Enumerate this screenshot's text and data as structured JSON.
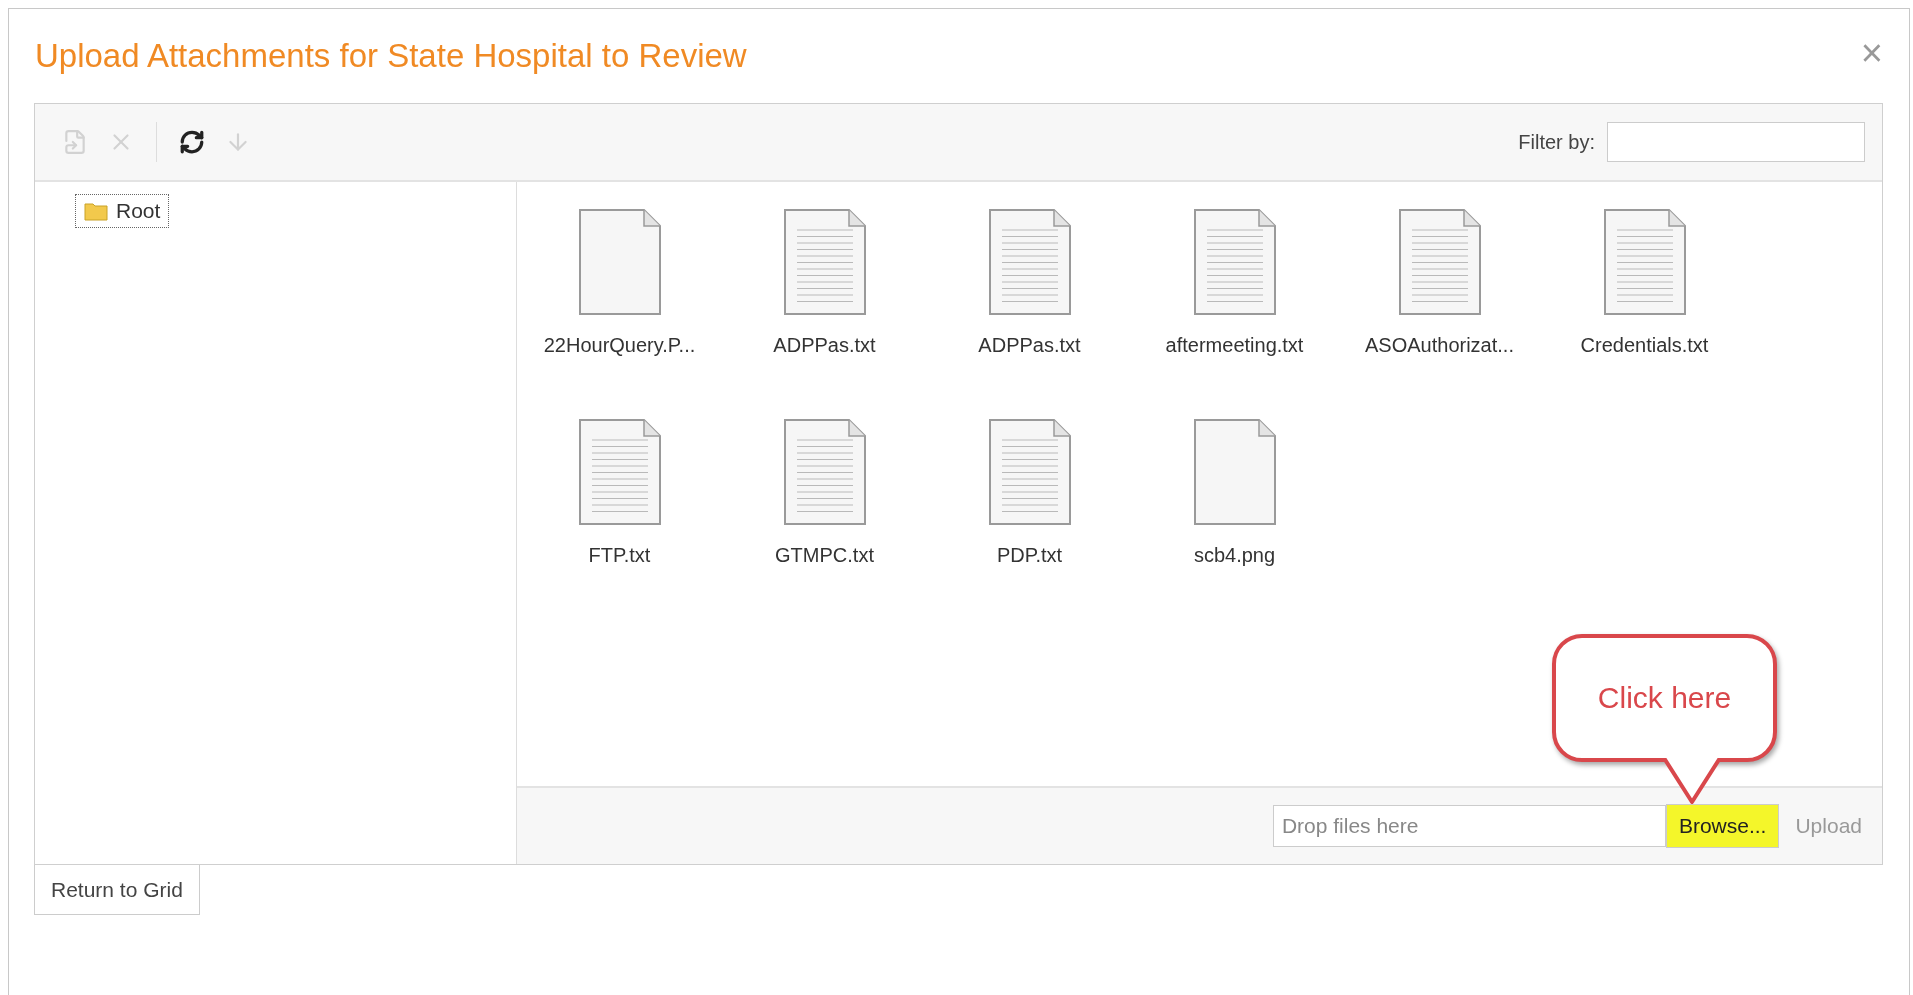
{
  "dialog": {
    "title": "Upload Attachments for State Hospital to Review",
    "close": "×"
  },
  "toolbar": {
    "tools": [
      {
        "kind": "new",
        "disabled": true
      },
      {
        "kind": "delete",
        "disabled": true
      },
      {
        "kind": "refresh",
        "disabled": false
      },
      {
        "kind": "download",
        "disabled": true
      }
    ],
    "filter_label": "Filter by:"
  },
  "tree": [
    {
      "label": "Root",
      "selected": true
    }
  ],
  "files": [
    {
      "name": "22HourQuery.P...",
      "kind": "blank"
    },
    {
      "name": "ADPPas.txt",
      "kind": "text"
    },
    {
      "name": "ADPPas.txt",
      "kind": "text"
    },
    {
      "name": "aftermeeting.txt",
      "kind": "text"
    },
    {
      "name": "ASOAuthorizat...",
      "kind": "text"
    },
    {
      "name": "Credentials.txt",
      "kind": "text"
    },
    {
      "name": "FTP.txt",
      "kind": "text"
    },
    {
      "name": "GTMPC.txt",
      "kind": "text"
    },
    {
      "name": "PDP.txt",
      "kind": "text"
    },
    {
      "name": "scb4.png",
      "kind": "blank"
    }
  ],
  "upload": {
    "placeholder": "Drop files here",
    "browse": {
      "label": "Browse...",
      "highlighted": true
    },
    "upload": {
      "label": "Upload",
      "disabled": true
    }
  },
  "callout": {
    "text": "Click here"
  },
  "return_button": "Return to Grid"
}
